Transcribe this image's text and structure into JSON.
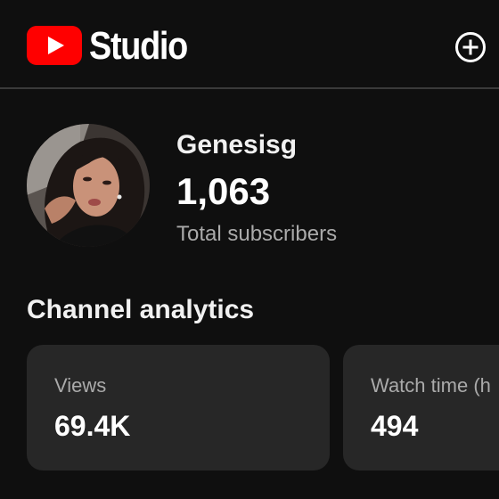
{
  "header": {
    "brand": "Studio",
    "logo_icon": "youtube-play-icon",
    "create_icon": "add-circle-icon",
    "brand_color": "#ff0000"
  },
  "channel": {
    "name": "Genesisg",
    "subscriber_count": "1,063",
    "subscriber_label": "Total subscribers"
  },
  "analytics": {
    "title": "Channel analytics",
    "cards": [
      {
        "label": "Views",
        "value": "69.4K"
      },
      {
        "label": "Watch time (h",
        "value": "494"
      }
    ]
  }
}
